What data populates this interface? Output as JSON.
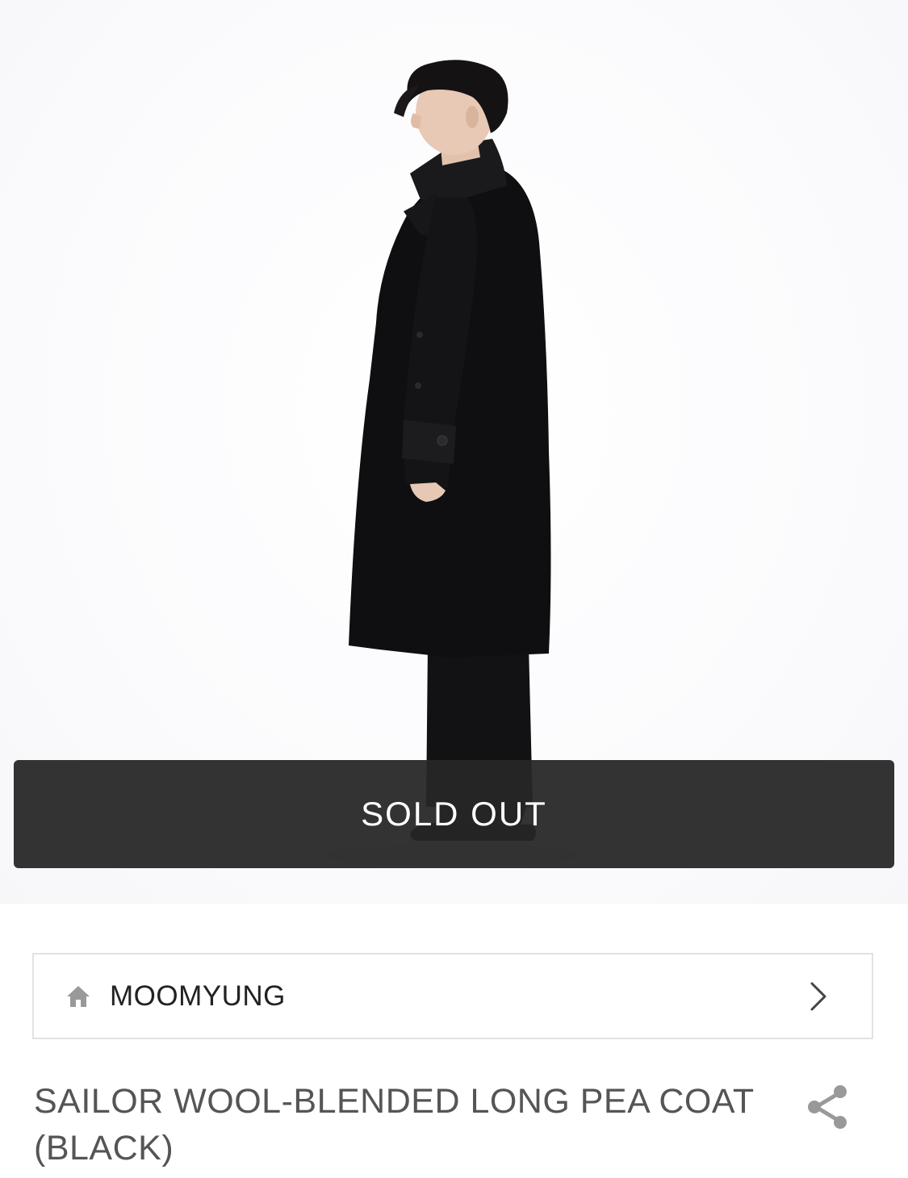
{
  "product_image": {
    "alt": "SAILOR WOOL-BLENDED LONG PEA COAT(BLACK)"
  },
  "status": {
    "sold_out_label": "SOLD OUT"
  },
  "brand": {
    "name": "MOOMYUNG",
    "icon": "home-icon",
    "chevron": "chevron-right-icon"
  },
  "product": {
    "title": "SAILOR WOOL-BLENDED LONG PEA COAT(BLACK)",
    "share_icon": "share-icon"
  },
  "colors": {
    "sold_out_bg": "#262626",
    "border": "#e2e2e2",
    "icon_gray": "#999999",
    "title_text": "#555555"
  }
}
